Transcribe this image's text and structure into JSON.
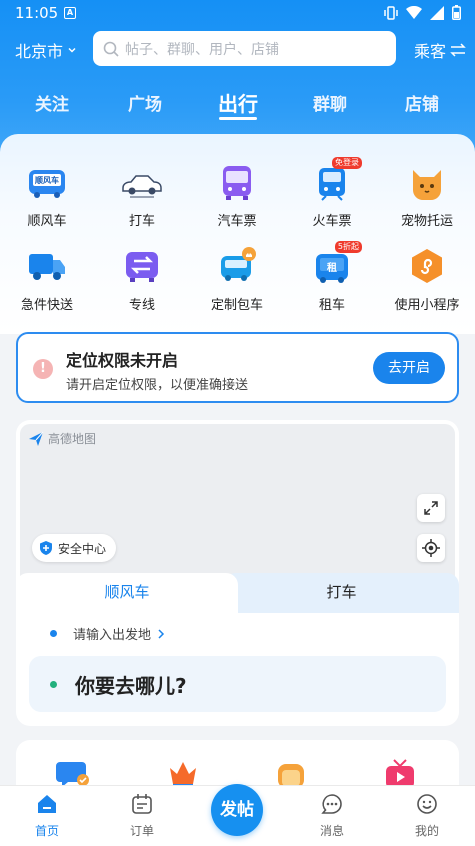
{
  "status_bar": {
    "time": "11:05",
    "notif": "A"
  },
  "header": {
    "city": "北京市",
    "search_placeholder": "帖子、群聊、用户、店铺",
    "role": "乘客"
  },
  "tabs": [
    {
      "label": "关注"
    },
    {
      "label": "广场"
    },
    {
      "label": "出行",
      "active": true
    },
    {
      "label": "群聊"
    },
    {
      "label": "店铺"
    }
  ],
  "services": [
    {
      "label": "顺风车",
      "icon": "carpool-car-icon",
      "icon_text": "顺风车"
    },
    {
      "label": "打车",
      "icon": "taxi-car-icon"
    },
    {
      "label": "汽车票",
      "icon": "bus-icon"
    },
    {
      "label": "火车票",
      "icon": "train-icon",
      "badge": "免登录"
    },
    {
      "label": "宠物托运",
      "icon": "pet-cat-icon"
    },
    {
      "label": "急件快送",
      "icon": "delivery-truck-icon"
    },
    {
      "label": "专线",
      "icon": "route-arrows-icon"
    },
    {
      "label": "定制包车",
      "icon": "charter-car-icon"
    },
    {
      "label": "租车",
      "icon": "rental-car-icon",
      "badge": "5折起",
      "icon_text": "租"
    },
    {
      "label": "使用小程序",
      "icon": "mini-program-icon"
    }
  ],
  "alert": {
    "title": "定位权限未开启",
    "subtitle": "请开启定位权限，以便准确接送",
    "button": "去开启"
  },
  "map": {
    "logo": "高德地图",
    "safety": "安全中心"
  },
  "ride": {
    "tab_carpool": "顺风车",
    "tab_taxi": "打车",
    "origin": "请输入出发地",
    "destination": "你要去哪儿?"
  },
  "nav": [
    {
      "label": "首页",
      "active": true
    },
    {
      "label": "订单"
    },
    {
      "label": "发帖"
    },
    {
      "label": "消息"
    },
    {
      "label": "我的"
    }
  ],
  "colors": {
    "primary": "#1a84ec",
    "header": "#1590f5",
    "origin_dot": "#1a84ec",
    "dest_dot": "#22b07d"
  }
}
